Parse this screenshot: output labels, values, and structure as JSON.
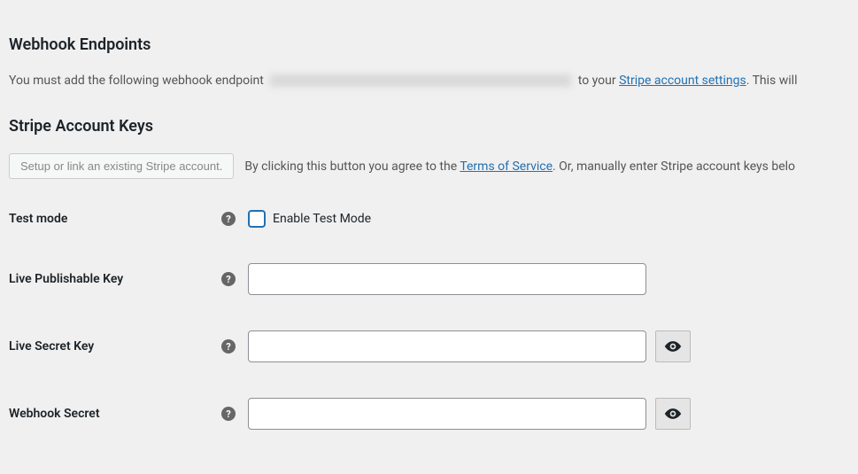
{
  "sections": {
    "webhook": {
      "heading": "Webhook Endpoints",
      "desc_prefix": "You must add the following webhook endpoint",
      "desc_mid": " to your ",
      "link_text": "Stripe account settings",
      "desc_suffix": ". This will"
    },
    "keys": {
      "heading": "Stripe Account Keys",
      "setup_btn": "Setup or link an existing Stripe account.",
      "setup_desc_prefix": "By clicking this button you agree to the ",
      "terms_link": "Terms of Service",
      "setup_desc_suffix": ". Or, manually enter Stripe account keys belo"
    }
  },
  "fields": {
    "test_mode": {
      "label": "Test mode",
      "checkbox_label": "Enable Test Mode"
    },
    "live_pub": {
      "label": "Live Publishable Key",
      "value": ""
    },
    "live_secret": {
      "label": "Live Secret Key",
      "value": ""
    },
    "webhook_secret": {
      "label": "Webhook Secret",
      "value": ""
    }
  }
}
